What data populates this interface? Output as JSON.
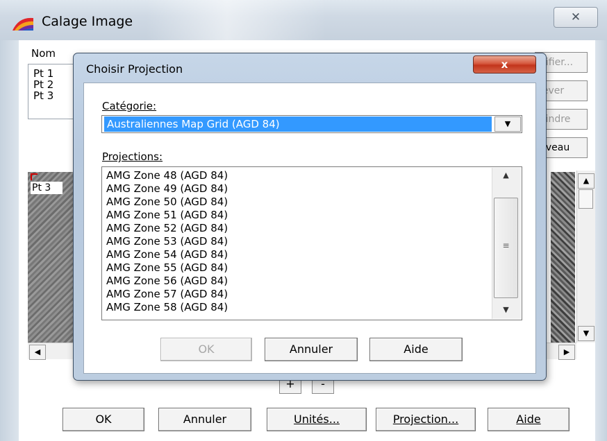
{
  "outer_window": {
    "title": "Calage Image",
    "close_glyph": "✕",
    "list": {
      "column_nom": "Nom",
      "items": [
        "Pt 1",
        "Pt 2",
        "Pt 3"
      ]
    },
    "side_buttons": [
      "difier...",
      "lever",
      "eindre",
      "uveau"
    ],
    "image_label": "Pt 3",
    "zoom_in": "+",
    "zoom_out": "-",
    "buttons": {
      "ok": "OK",
      "annuler": "Annuler",
      "unites": "Unités...",
      "projection": "Projection...",
      "aide": "Aide"
    }
  },
  "dialog": {
    "title": "Choisir Projection",
    "close_glyph": "x",
    "categorie_label": "Catégorie:",
    "categorie_value": "Australiennes Map Grid (AGD 84)",
    "projections_label": "Projections:",
    "projections": [
      "AMG Zone 48 (AGD 84)",
      "AMG Zone 49 (AGD 84)",
      "AMG Zone 50 (AGD 84)",
      "AMG Zone 51 (AGD 84)",
      "AMG Zone 52 (AGD 84)",
      "AMG Zone 53 (AGD 84)",
      "AMG Zone 54 (AGD 84)",
      "AMG Zone 55 (AGD 84)",
      "AMG Zone 56 (AGD 84)",
      "AMG Zone 57 (AGD 84)",
      "AMG Zone 58 (AGD 84)"
    ],
    "buttons": {
      "ok": "OK",
      "annuler": "Annuler",
      "aide": "Aide"
    }
  },
  "icons": {
    "app": "app-logo-icon",
    "dropdown": "chevron-down-icon",
    "scroll_up": "arrow-up-icon",
    "scroll_down": "arrow-down-icon",
    "scroll_left": "arrow-left-icon",
    "scroll_right": "arrow-right-icon"
  },
  "colors": {
    "selection": "#3399ff",
    "close_red": "#c2351c",
    "frame_blue": "#bccde0"
  }
}
